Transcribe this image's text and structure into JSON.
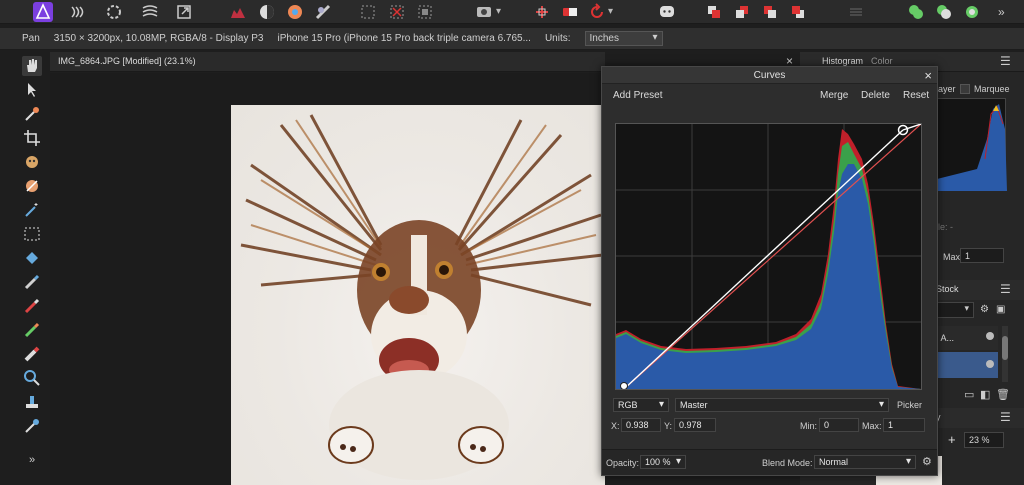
{
  "context": {
    "tool_name": "Pan",
    "doc_info": "3150 × 3200px, 10.08MP, RGBA/8 - Display P3",
    "camera": "iPhone 15 Pro (iPhone 15 Pro back triple camera 6.765...",
    "units_label": "Units:",
    "units_value": "Inches"
  },
  "document_tab": {
    "title": "IMG_6864.JPG [Modified] (23.1%)",
    "close": "×"
  },
  "right_panel": {
    "tab_histogram": "Histogram",
    "tab_color": "Color",
    "layer_label": "ayer",
    "marquee_label": "Marquee",
    "faint_label": "le: -",
    "max_label": "Max",
    "max_value": "1",
    "stock_label": "Stock",
    "layer_item_label": ": A...",
    "zoom_value": "23 %",
    "y_label": "y"
  },
  "curves": {
    "title": "Curves",
    "close": "×",
    "add_preset": "Add Preset",
    "merge": "Merge",
    "delete": "Delete",
    "reset": "Reset",
    "channel": "RGB",
    "mode": "Master",
    "picker": "Picker",
    "x_label": "X:",
    "x_value": "0.938",
    "y_label": "Y:",
    "y_value": "0.978",
    "min_label": "Min:",
    "min_value": "0",
    "max_label": "Max:",
    "max_value": "1",
    "opacity_label": "Opacity:",
    "opacity_value": "100 %",
    "blend_label": "Blend Mode:",
    "blend_value": "Normal"
  },
  "colors": {
    "accent": "#4a78c4",
    "histogram_blue": "#2a5aa8",
    "histogram_red": "#c0202a",
    "histogram_green": "#3aa04a",
    "app_logo": "#8a3fe0"
  }
}
